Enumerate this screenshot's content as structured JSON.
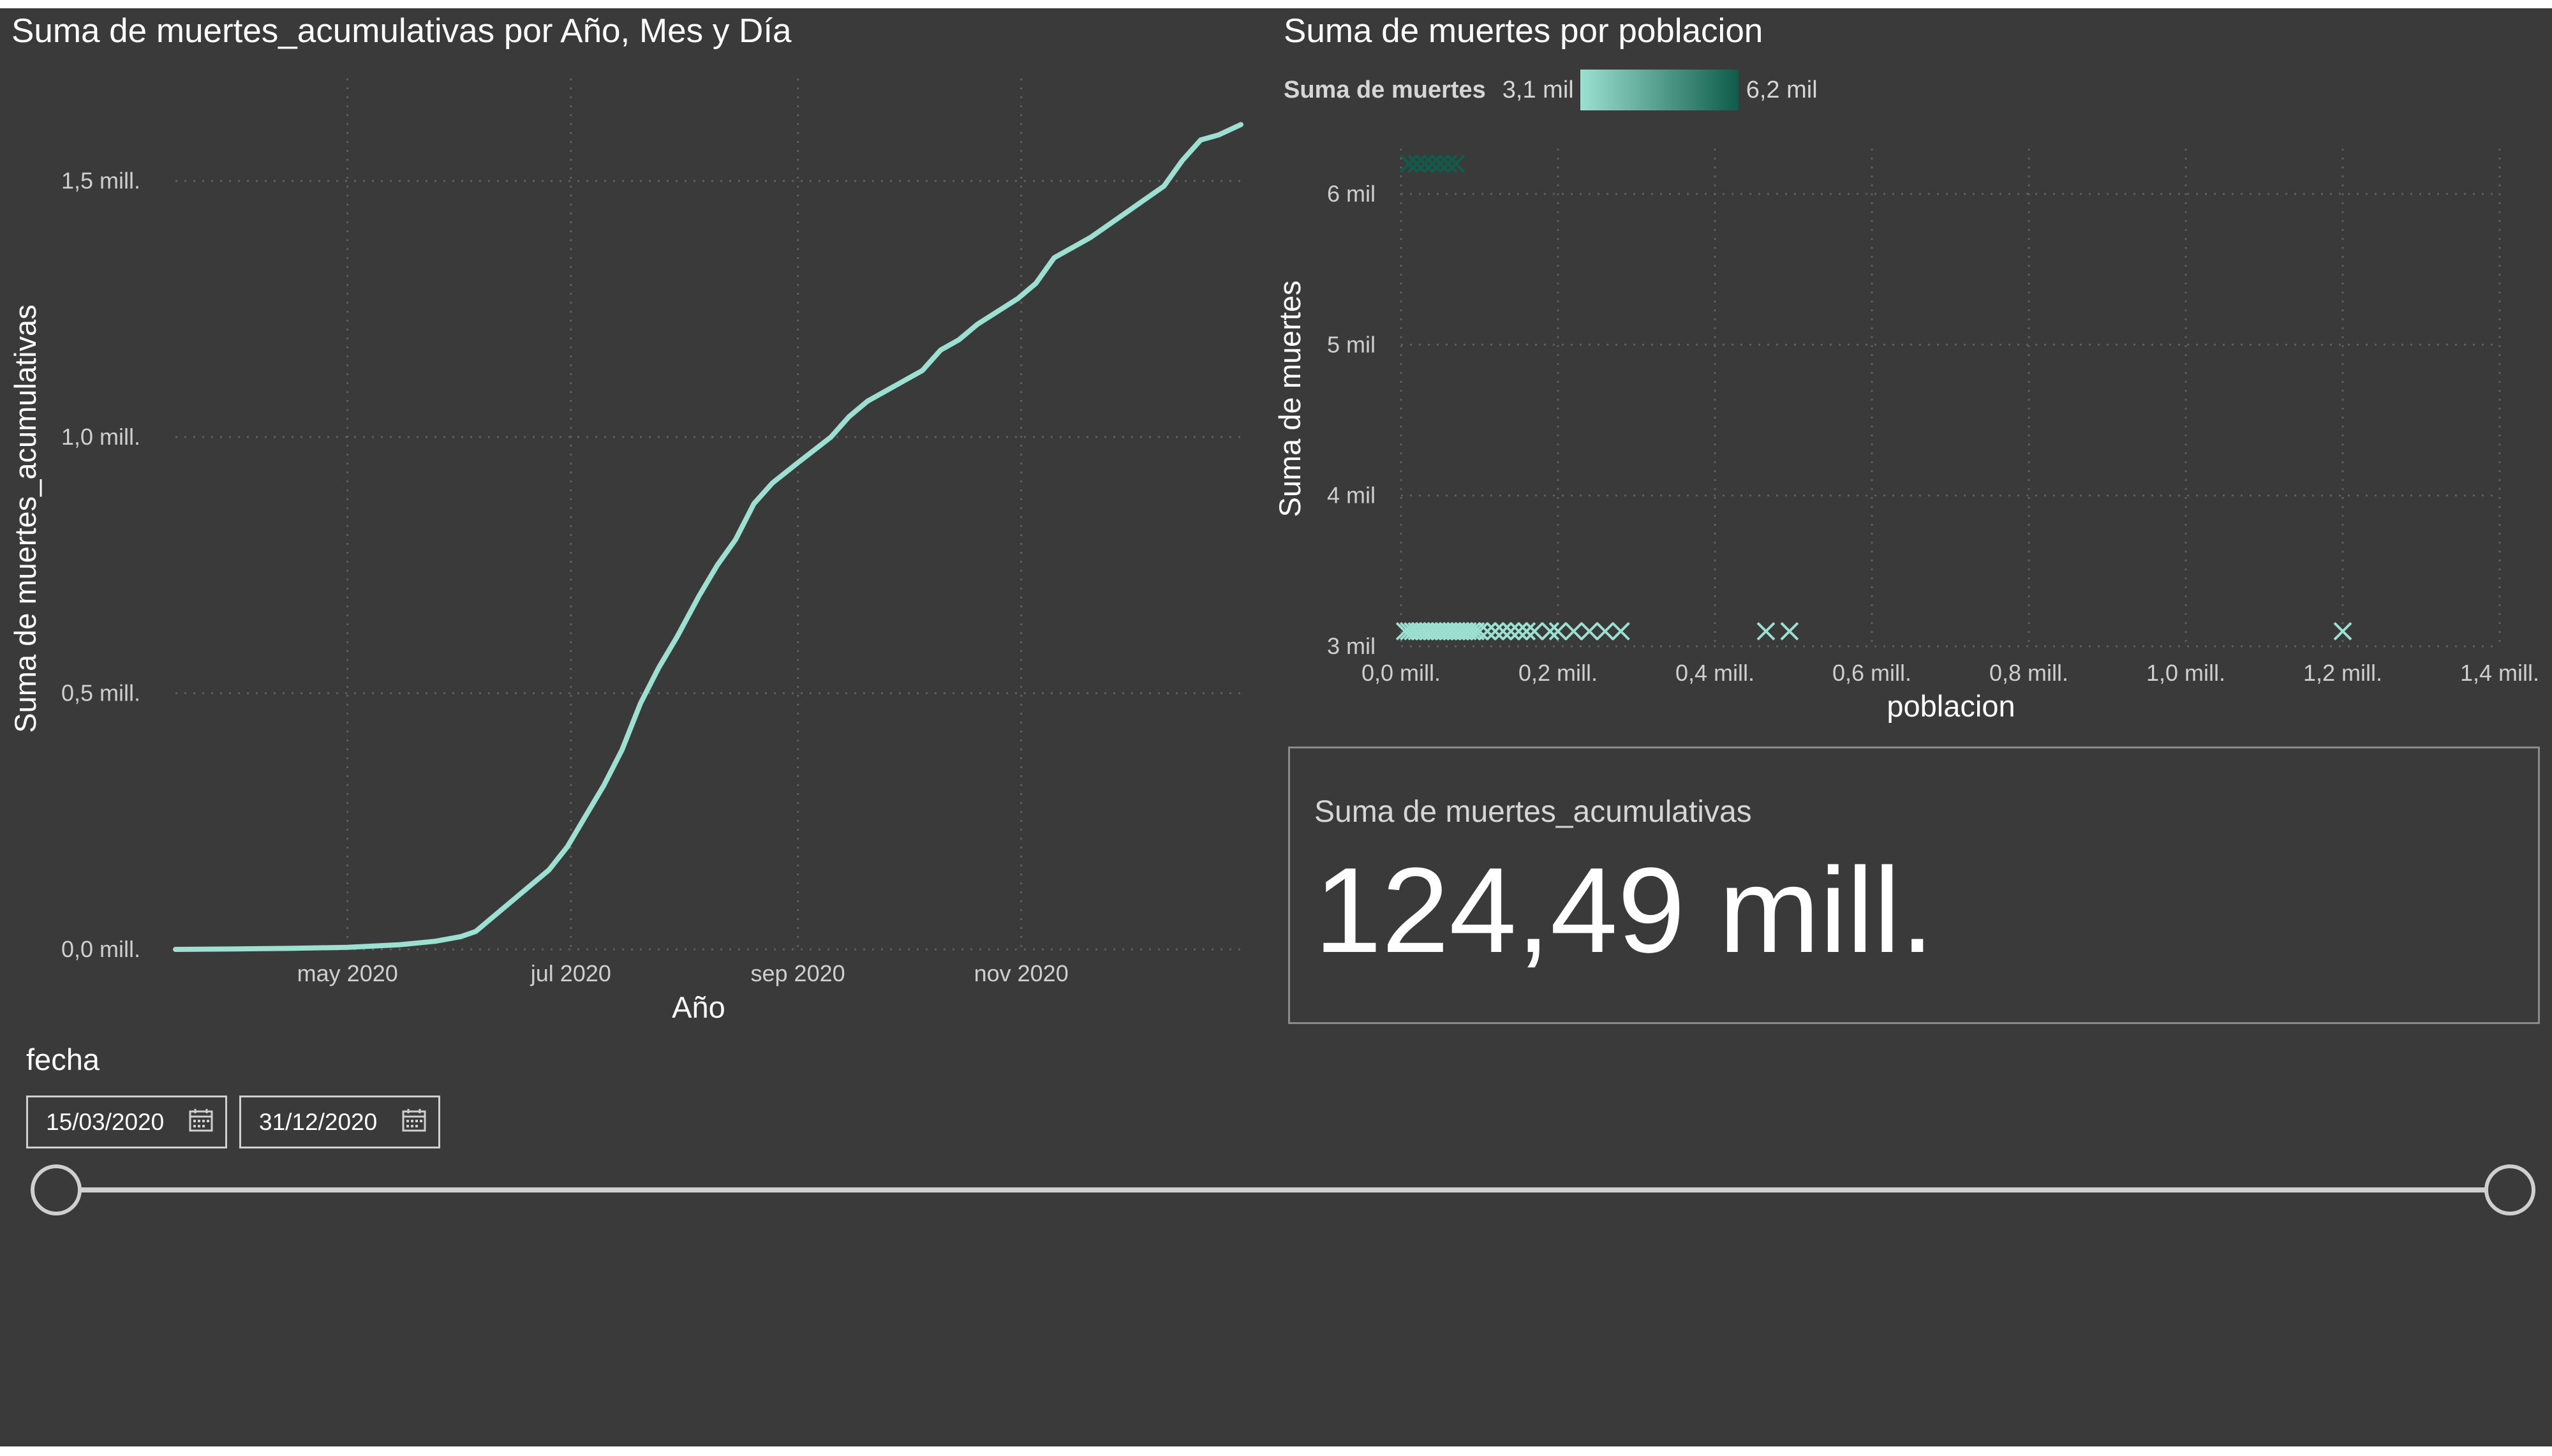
{
  "theme": {
    "background": "#3a3a3a",
    "accent": "#9be0d0",
    "accent_dark": "#0f5c4a",
    "text": "#ffffff",
    "muted": "#cfcfcf"
  },
  "line_visual": {
    "title": "Suma de muertes_acumulativas por Año, Mes y Día"
  },
  "scatter_visual": {
    "title": "Suma de muertes por poblacion",
    "legend": {
      "label": "Suma de muertes",
      "min_label": "3,1 mil",
      "max_label": "6,2 mil"
    }
  },
  "card": {
    "label": "Suma de muertes_acumulativas",
    "value": "124,49 mill."
  },
  "slicer": {
    "title": "fecha",
    "start_date": "15/03/2020",
    "end_date": "31/12/2020",
    "range_fraction": [
      0,
      1
    ]
  },
  "chart_data": [
    {
      "type": "line",
      "title": "Suma de muertes_acumulativas por Año, Mes y Día",
      "xlabel": "Año",
      "ylabel": "Suma de muertes_acumulativas",
      "x_ticks": [
        "may 2020",
        "jul 2020",
        "sep 2020",
        "nov 2020"
      ],
      "y_ticks": [
        "0,0 mill.",
        "0,5 mill.",
        "1,0 mill.",
        "1,5 mill."
      ],
      "y_tick_values": [
        0,
        500000,
        1000000,
        1500000
      ],
      "ylim": [
        0,
        1700000
      ],
      "xlim": [
        "2020-03-15",
        "2020-12-31"
      ],
      "grid": true,
      "series": [
        {
          "color": "#9be0d0",
          "points": [
            [
              "2020-03-15",
              0
            ],
            [
              "2020-04-01",
              1000
            ],
            [
              "2020-04-15",
              2000
            ],
            [
              "2020-05-01",
              4000
            ],
            [
              "2020-05-15",
              9000
            ],
            [
              "2020-05-25",
              16000
            ],
            [
              "2020-06-01",
              25000
            ],
            [
              "2020-06-05",
              35000
            ],
            [
              "2020-06-10",
              65000
            ],
            [
              "2020-06-15",
              95000
            ],
            [
              "2020-06-20",
              125000
            ],
            [
              "2020-06-25",
              155000
            ],
            [
              "2020-06-30",
              200000
            ],
            [
              "2020-07-05",
              260000
            ],
            [
              "2020-07-10",
              320000
            ],
            [
              "2020-07-15",
              390000
            ],
            [
              "2020-07-20",
              480000
            ],
            [
              "2020-07-25",
              550000
            ],
            [
              "2020-07-30",
              610000
            ],
            [
              "2020-08-05",
              690000
            ],
            [
              "2020-08-10",
              750000
            ],
            [
              "2020-08-15",
              800000
            ],
            [
              "2020-08-20",
              870000
            ],
            [
              "2020-08-25",
              910000
            ],
            [
              "2020-09-01",
              950000
            ],
            [
              "2020-09-10",
              1000000
            ],
            [
              "2020-09-15",
              1040000
            ],
            [
              "2020-09-20",
              1070000
            ],
            [
              "2020-09-30",
              1110000
            ],
            [
              "2020-10-05",
              1130000
            ],
            [
              "2020-10-10",
              1170000
            ],
            [
              "2020-10-15",
              1190000
            ],
            [
              "2020-10-20",
              1220000
            ],
            [
              "2020-10-31",
              1270000
            ],
            [
              "2020-11-05",
              1300000
            ],
            [
              "2020-11-10",
              1350000
            ],
            [
              "2020-11-15",
              1370000
            ],
            [
              "2020-11-20",
              1390000
            ],
            [
              "2020-11-30",
              1440000
            ],
            [
              "2020-12-10",
              1490000
            ],
            [
              "2020-12-15",
              1540000
            ],
            [
              "2020-12-20",
              1580000
            ],
            [
              "2020-12-25",
              1590000
            ],
            [
              "2020-12-31",
              1610000
            ]
          ]
        }
      ]
    },
    {
      "type": "scatter",
      "title": "Suma de muertes por poblacion",
      "xlabel": "poblacion",
      "ylabel": "Suma de muertes",
      "x_ticks": [
        "0,0 mill.",
        "0,2 mill.",
        "0,4 mill.",
        "0,6 mill.",
        "0,8 mill.",
        "1,0 mill.",
        "1,2 mill.",
        "1,4 mill."
      ],
      "x_tick_values": [
        0,
        200000,
        400000,
        600000,
        800000,
        1000000,
        1200000,
        1400000
      ],
      "y_ticks": [
        "3 mil",
        "4 mil",
        "5 mil",
        "6 mil"
      ],
      "y_tick_values": [
        3000,
        4000,
        5000,
        6000
      ],
      "xlim": [
        0,
        1400000
      ],
      "ylim": [
        3000,
        6300
      ],
      "grid": true,
      "marker": "x",
      "color_scale": [
        "#9be0d0",
        "#0f5c4a"
      ],
      "series": [
        {
          "points": [
            [
              5000,
              3100
            ],
            [
              10000,
              3100
            ],
            [
              15000,
              3100
            ],
            [
              20000,
              3100
            ],
            [
              25000,
              3100
            ],
            [
              30000,
              3100
            ],
            [
              35000,
              3100
            ],
            [
              40000,
              3100
            ],
            [
              45000,
              3100
            ],
            [
              50000,
              3100
            ],
            [
              55000,
              3100
            ],
            [
              60000,
              3100
            ],
            [
              65000,
              3100
            ],
            [
              70000,
              3100
            ],
            [
              75000,
              3100
            ],
            [
              80000,
              3100
            ],
            [
              85000,
              3100
            ],
            [
              90000,
              3100
            ],
            [
              95000,
              3100
            ],
            [
              100000,
              3100
            ],
            [
              110000,
              3100
            ],
            [
              120000,
              3100
            ],
            [
              130000,
              3100
            ],
            [
              140000,
              3100
            ],
            [
              150000,
              3100
            ],
            [
              160000,
              3100
            ],
            [
              170000,
              3100
            ],
            [
              190000,
              3100
            ],
            [
              200000,
              3100
            ],
            [
              220000,
              3100
            ],
            [
              240000,
              3100
            ],
            [
              260000,
              3100
            ],
            [
              280000,
              3100
            ],
            [
              465000,
              3100
            ],
            [
              495000,
              3100
            ],
            [
              1200000,
              3100
            ],
            [
              10000,
              6200
            ],
            [
              20000,
              6200
            ],
            [
              30000,
              6200
            ],
            [
              40000,
              6200
            ],
            [
              50000,
              6200
            ],
            [
              60000,
              6200
            ],
            [
              70000,
              6200
            ]
          ]
        }
      ]
    }
  ]
}
